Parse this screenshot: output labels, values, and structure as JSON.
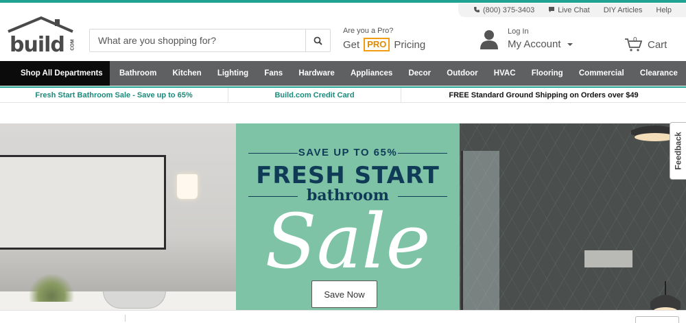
{
  "utility": {
    "phone": "(800) 375-3403",
    "live_chat": "Live Chat",
    "diy_articles": "DIY Articles",
    "help": "Help"
  },
  "logo": {
    "word": "build",
    "suffix": "COM"
  },
  "search": {
    "placeholder": "What are you shopping for?"
  },
  "pro": {
    "question": "Are you a Pro?",
    "get": "Get",
    "badge": "PRO",
    "pricing": "Pricing"
  },
  "account": {
    "login": "Log In",
    "label": "My Account"
  },
  "cart": {
    "count": "0",
    "label": "Cart"
  },
  "nav": {
    "all": "Shop All Departments",
    "items": [
      "Bathroom",
      "Kitchen",
      "Lighting",
      "Fans",
      "Hardware",
      "Appliances",
      "Decor",
      "Outdoor",
      "HVAC",
      "Flooring",
      "Commercial",
      "Clearance"
    ]
  },
  "promo": {
    "sale": "Fresh Start Bathroom Sale - Save up to 65%",
    "credit": "Build.com Credit Card",
    "shipping": "FREE Standard Ground Shipping on Orders over $49"
  },
  "hero": {
    "save": "SAVE UP TO 65%",
    "fresh": "FRESH START",
    "bathroom": "bathroom",
    "sale": "Sale",
    "cta": "Save Now"
  },
  "feedback": "Feedback",
  "colors": {
    "accent": "#1fa390",
    "nav_bg": "#5f6062",
    "nav_all_bg": "#0b0b0b",
    "hero_green": "#7ec3a6",
    "headline_navy": "#0f3b57",
    "pro_orange": "#f39c12"
  }
}
